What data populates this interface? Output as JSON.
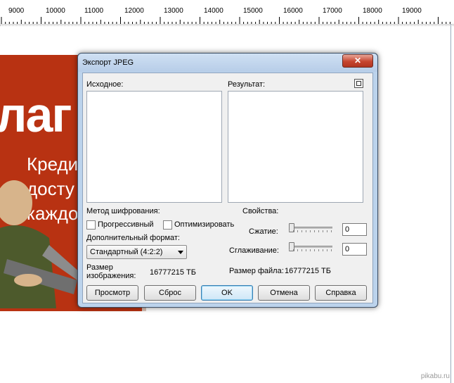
{
  "ruler": {
    "labels": [
      "9000",
      "10000",
      "11000",
      "12000",
      "13000",
      "14000",
      "15000",
      "16000",
      "17000",
      "18000",
      "19000"
    ]
  },
  "artwork": {
    "big_text": "лаг",
    "lines": [
      "Креди",
      "досту",
      "каждо"
    ]
  },
  "dialog": {
    "title": "Экспорт JPEG",
    "close_glyph": "✕",
    "original_label": "Исходное:",
    "result_label": "Результат:",
    "encoding_label": "Метод шифрования:",
    "progressive_label": "Прогрессивный",
    "optimize_label": "Оптимизировать",
    "properties_label": "Свойства:",
    "compression_label": "Сжатие:",
    "compression_value": "0",
    "smoothing_label": "Сглаживание:",
    "smoothing_value": "0",
    "extra_format_label": "Дополнительный формат:",
    "extra_format_value": "Стандартный (4:2:2)",
    "image_size_label_1": "Размер",
    "image_size_label_2": "изображения:",
    "image_size_value": "16777215 ТБ",
    "file_size_label": "Размер файла:",
    "file_size_value": "16777215 ТБ",
    "buttons": {
      "preview": "Просмотр",
      "reset": "Сброс",
      "ok": "OK",
      "cancel": "Отмена",
      "help": "Справка"
    }
  },
  "watermark": "pikabu.ru"
}
